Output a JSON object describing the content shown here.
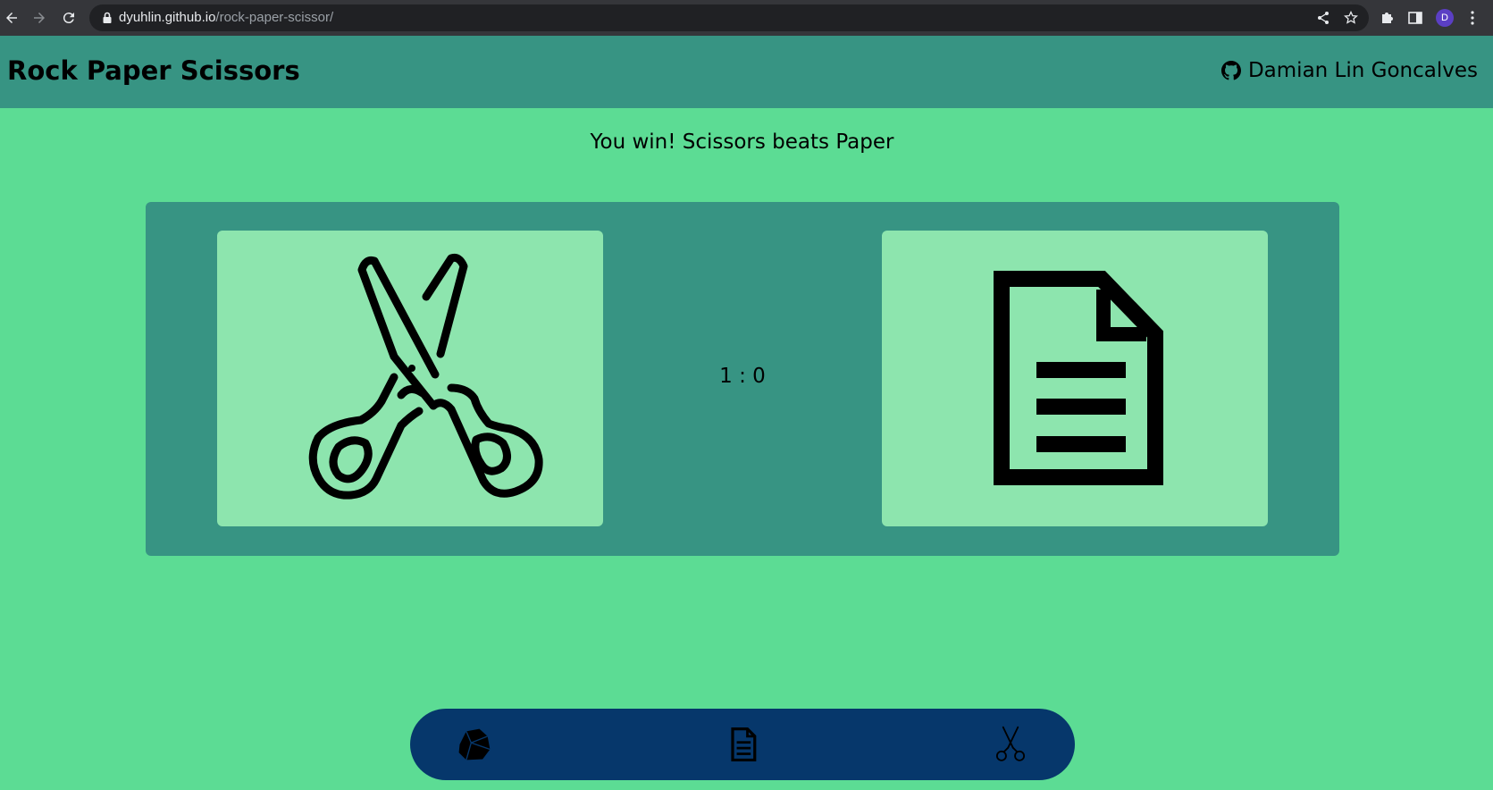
{
  "browser": {
    "url_domain": "dyuhlin.github.io",
    "url_path": "/rock-paper-scissor/",
    "profile_initial": "D",
    "icons": [
      "back-icon",
      "forward-icon",
      "reload-icon",
      "lock-icon",
      "share-icon",
      "star-icon",
      "extensions-icon",
      "side-panel-icon",
      "menu-icon"
    ]
  },
  "header": {
    "title": "Rock Paper Scissors",
    "author": "Damian Lin Goncalves",
    "author_icon": "github-icon"
  },
  "game": {
    "result_text": "You win! Scissors beats Paper",
    "score": "1 : 0",
    "player_choice": "scissors-icon",
    "computer_choice": "paper-icon"
  },
  "choices": [
    "rock-icon",
    "paper-icon",
    "scissors-icon"
  ],
  "colors": {
    "page_bg": "#5cdc94",
    "header_bg": "#379483",
    "card_bg": "#8de5ae",
    "choices_bar_bg": "#06376b"
  }
}
